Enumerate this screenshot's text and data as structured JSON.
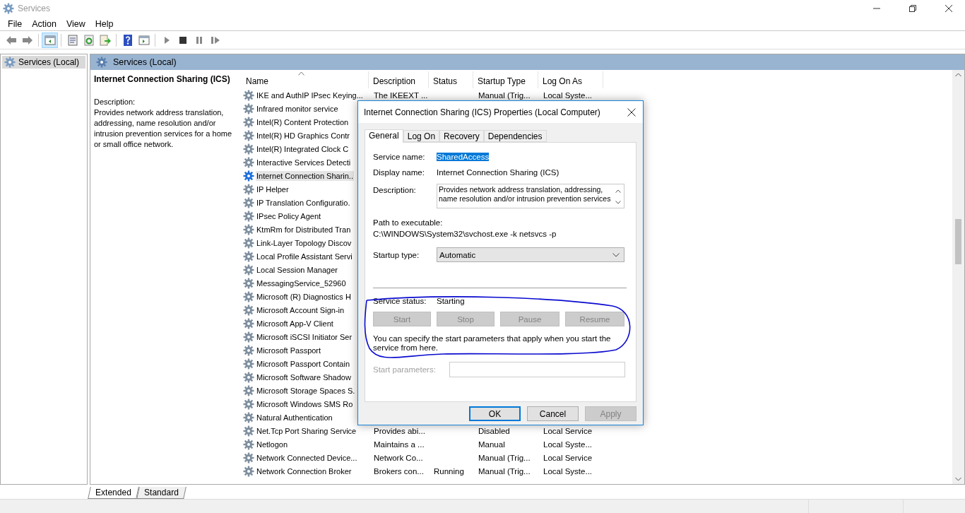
{
  "window": {
    "title": "Services"
  },
  "menu": [
    "File",
    "Action",
    "View",
    "Help"
  ],
  "toolbar": {
    "groups": [
      [
        {
          "kind": "back",
          "selected": false
        },
        {
          "kind": "forward",
          "selected": false
        }
      ],
      [
        {
          "kind": "tree",
          "selected": true
        }
      ],
      [
        {
          "kind": "properties",
          "selected": false
        },
        {
          "kind": "refresh",
          "selected": false
        },
        {
          "kind": "export",
          "selected": false
        }
      ],
      [
        {
          "kind": "help",
          "selected": false
        },
        {
          "kind": "view",
          "selected": false
        }
      ],
      [
        {
          "kind": "play",
          "selected": false
        },
        {
          "kind": "stop",
          "selected": false
        },
        {
          "kind": "pause",
          "selected": false
        },
        {
          "kind": "restart",
          "selected": false
        }
      ]
    ]
  },
  "tree": [
    {
      "label": "Services (Local)",
      "selected": true
    }
  ],
  "panel_header": "Services (Local)",
  "details": {
    "title": "Internet Connection Sharing (ICS)",
    "description_label": "Description:",
    "description": "Provides network address translation, addressing, name resolution and/or intrusion prevention services for a home or small office network."
  },
  "table": {
    "columns": [
      {
        "label": "Name",
        "sorted": true
      },
      {
        "label": "Description",
        "sorted": false
      },
      {
        "label": "Status",
        "sorted": false
      },
      {
        "label": "Startup Type",
        "sorted": false
      },
      {
        "label": "Log On As",
        "sorted": false
      }
    ],
    "rows": [
      {
        "name": "IKE and AuthIP IPsec Keying...",
        "description": "The IKEEXT ...",
        "startup_type": "Manual (Trig...",
        "log_on_as": "Local Syste...",
        "selected": false
      },
      {
        "name": "Infrared monitor service",
        "selected": false
      },
      {
        "name": "Intel(R) Content Protection",
        "selected": false
      },
      {
        "name": "Intel(R) HD Graphics Contr",
        "selected": false
      },
      {
        "name": "Intel(R) Integrated Clock C",
        "selected": false
      },
      {
        "name": "Interactive Services Detecti",
        "selected": false
      },
      {
        "name": "Internet Connection Sharin..",
        "selected": true
      },
      {
        "name": "IP Helper",
        "selected": false
      },
      {
        "name": "IP Translation Configuratio.",
        "selected": false
      },
      {
        "name": "IPsec Policy Agent",
        "selected": false
      },
      {
        "name": "KtmRm for Distributed Tran",
        "selected": false
      },
      {
        "name": "Link-Layer Topology Discov",
        "selected": false
      },
      {
        "name": "Local Profile Assistant Servi",
        "selected": false
      },
      {
        "name": "Local Session Manager",
        "selected": false
      },
      {
        "name": "MessagingService_52960",
        "selected": false
      },
      {
        "name": "Microsoft (R) Diagnostics H",
        "selected": false
      },
      {
        "name": "Microsoft Account Sign-in",
        "selected": false
      },
      {
        "name": "Microsoft App-V Client",
        "selected": false
      },
      {
        "name": "Microsoft iSCSI Initiator Ser",
        "selected": false
      },
      {
        "name": "Microsoft Passport",
        "selected": false
      },
      {
        "name": "Microsoft Passport Contain",
        "selected": false
      },
      {
        "name": "Microsoft Software Shadow",
        "selected": false
      },
      {
        "name": "Microsoft Storage Spaces S.",
        "selected": false
      },
      {
        "name": "Microsoft Windows SMS Ro",
        "selected": false
      },
      {
        "name": "Natural Authentication",
        "selected": false
      },
      {
        "name": "Net.Tcp Port Sharing Service",
        "description": "Provides abi...",
        "startup_type": "Disabled",
        "log_on_as": "Local Service",
        "selected": false
      },
      {
        "name": "Netlogon",
        "description": "Maintains a ...",
        "startup_type": "Manual",
        "log_on_as": "Local Syste...",
        "selected": false
      },
      {
        "name": "Network Connected Device...",
        "description": "Network Co...",
        "startup_type": "Manual (Trig...",
        "log_on_as": "Local Service",
        "selected": false
      },
      {
        "name": "Network Connection Broker",
        "description": "Brokers con...",
        "status": "Running",
        "startup_type": "Manual (Trig...",
        "log_on_as": "Local Syste...",
        "selected": false
      }
    ]
  },
  "view_tabs": [
    {
      "label": "Extended",
      "selected": true
    },
    {
      "label": "Standard",
      "selected": false
    }
  ],
  "dialog": {
    "title": "Internet Connection Sharing (ICS) Properties (Local Computer)",
    "tabs": [
      {
        "label": "General",
        "selected": true
      },
      {
        "label": "Log On",
        "selected": false
      },
      {
        "label": "Recovery",
        "selected": false
      },
      {
        "label": "Dependencies",
        "selected": false
      }
    ],
    "service_name": {
      "label": "Service name:",
      "value": "SharedAccess",
      "highlighted": true
    },
    "display_name": {
      "label": "Display name:",
      "value": "Internet Connection Sharing (ICS)"
    },
    "description": {
      "label": "Description:",
      "value": "Provides network address translation, addressing, name resolution and/or intrusion prevention services"
    },
    "path": {
      "label": "Path to executable:",
      "value": "C:\\WINDOWS\\System32\\svchost.exe -k netsvcs -p"
    },
    "startup_type": {
      "label": "Startup type:",
      "value": "Automatic"
    },
    "service_status": {
      "label": "Service status:",
      "value": "Starting"
    },
    "control_buttons": [
      {
        "label": "Start",
        "disabled": true
      },
      {
        "label": "Stop",
        "disabled": true
      },
      {
        "label": "Pause",
        "disabled": true
      },
      {
        "label": "Resume",
        "disabled": true
      }
    ],
    "hint": "You can specify the start parameters that apply when you start the service from here.",
    "start_parameters": {
      "label": "Start parameters:",
      "disabled": true
    },
    "buttons": [
      {
        "label": "OK",
        "default": true,
        "disabled": false
      },
      {
        "label": "Cancel",
        "default": false,
        "disabled": false
      },
      {
        "label": "Apply",
        "default": false,
        "disabled": true
      }
    ],
    "annotations": [
      {
        "kind": "loop"
      }
    ]
  }
}
